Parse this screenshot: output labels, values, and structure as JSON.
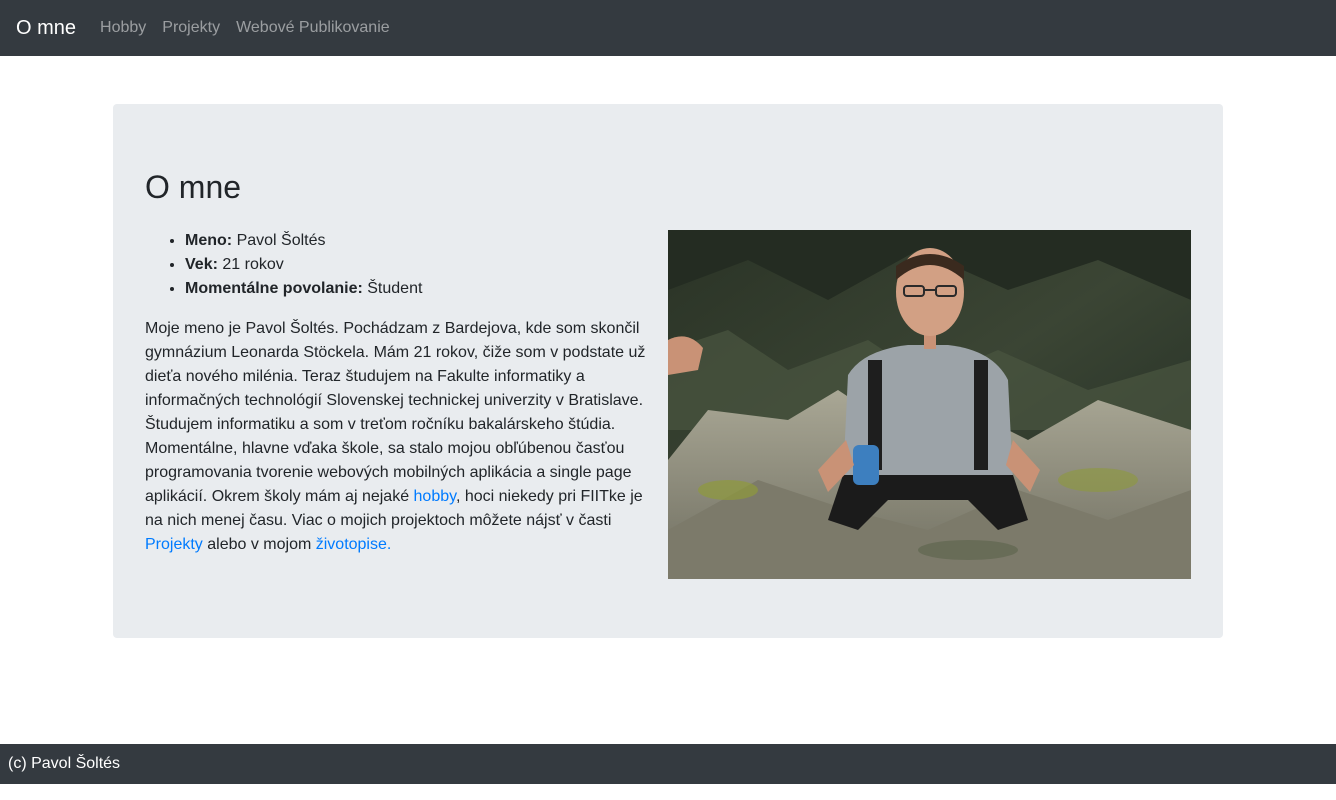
{
  "navbar": {
    "brand": "O mne",
    "links": [
      "Hobby",
      "Projekty",
      "Webové Publikovanie"
    ]
  },
  "main": {
    "title": "O mne",
    "info": [
      {
        "label": "Meno:",
        "value": "Pavol Šoltés"
      },
      {
        "label": "Vek:",
        "value": "21 rokov"
      },
      {
        "label": "Momentálne povolanie:",
        "value": "Študent"
      }
    ],
    "bio": {
      "text1": "Moje meno je Pavol Šoltés. Pochádzam z Bardejova, kde som skončil gymnázium Leonarda Stöckela. Mám 21 rokov, čiže som v podstate už dieťa nového milénia. Teraz študujem na Fakulte informatiky a informačných technológií Slovenskej technickej univerzity v Bratislave. Študujem informatiku a som v treťom ročníku bakalárskeho štúdia. Momentálne, hlavne vďaka škole, sa stalo mojou obľúbenou časťou programovania tvorenie webových mobilných aplikácia a single page aplikácií. Okrem školy mám aj nejaké ",
      "link_hobby": "hobby",
      "text2": ", hoci niekedy pri FIITke je na nich menej času. Viac o mojich projektoch môžete nájsť v časti ",
      "link_projekty": "Projekty",
      "text3": " alebo v mojom ",
      "link_zivotopis": "životopise."
    }
  },
  "footer": {
    "text": "(c) Pavol Šoltés"
  },
  "colors": {
    "navbar_bg": "#343a40",
    "jumbotron_bg": "#e9ecef",
    "link": "#007bff"
  }
}
